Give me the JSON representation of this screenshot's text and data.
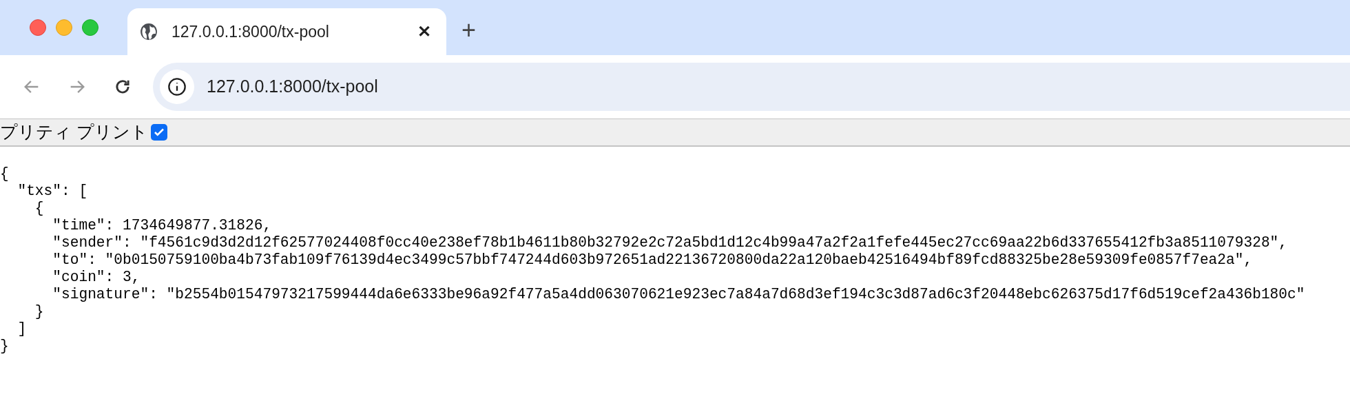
{
  "tab": {
    "title": "127.0.0.1:8000/tx-pool",
    "close": "✕",
    "new_tab": "+"
  },
  "address_bar": {
    "url": "127.0.0.1:8000/tx-pool"
  },
  "pretty_print": {
    "label": "プリティ プリント",
    "checked": true
  },
  "json_lines": [
    "{",
    "  \"txs\": [",
    "    {",
    "      \"time\": 1734649877.31826,",
    "      \"sender\": \"f4561c9d3d2d12f62577024408f0cc40e238ef78b1b4611b80b32792e2c72a5bd1d12c4b99a47a2f2a1fefe445ec27cc69aa22b6d337655412fb3a8511079328\",",
    "      \"to\": \"0b0150759100ba4b73fab109f76139d4ec3499c57bbf747244d603b972651ad22136720800da22a120baeb42516494bf89fcd88325be28e59309fe0857f7ea2a\",",
    "      \"coin\": 3,",
    "      \"signature\": \"b2554b01547973217599444da6e6333be96a92f477a5a4dd063070621e923ec7a84a7d68d3ef194c3c3d87ad6c3f20448ebc626375d17f6d519cef2a436b180c\"",
    "    }",
    "  ]",
    "}"
  ]
}
